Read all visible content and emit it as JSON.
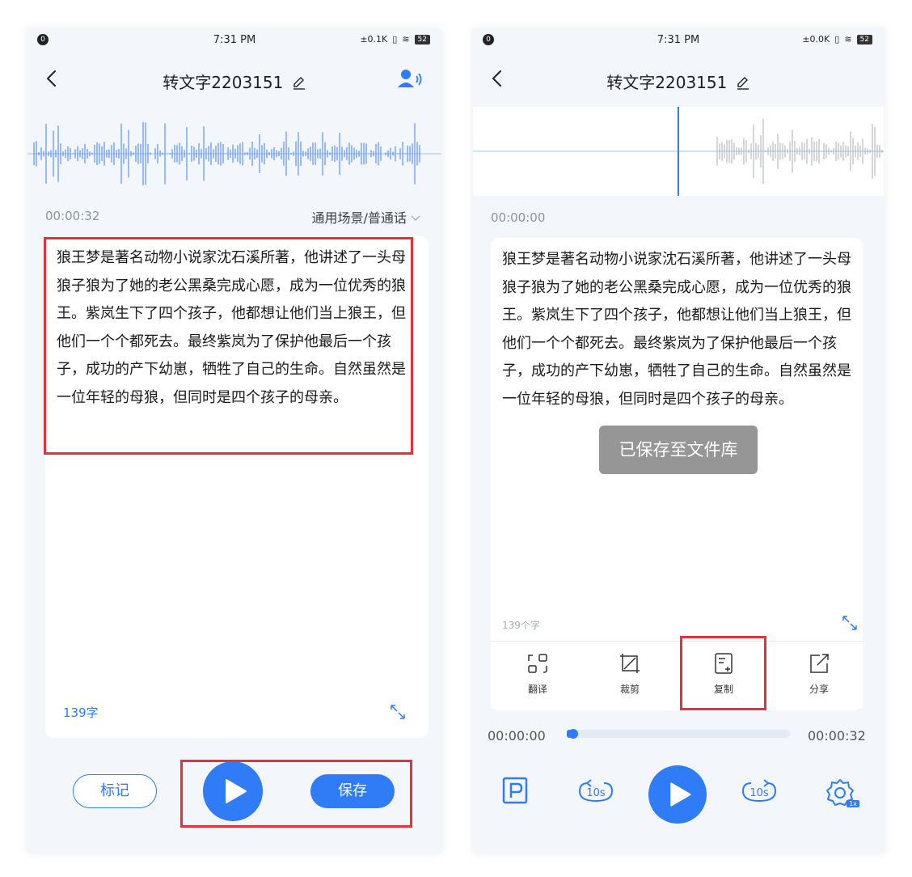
{
  "status_bar": {
    "time": "7:31 PM",
    "net_left": "±0.1K",
    "net_right": "±0.0K",
    "battery": "52",
    "notif_left": "0",
    "notif_right": "0"
  },
  "nav": {
    "title": "转文字2203151"
  },
  "left": {
    "time": "00:00:32",
    "scene": "通用场景/普通话",
    "transcript": "狼王梦是著名动物小说家沈石溪所著，他讲述了一头母狼子狼为了她的老公黑桑完成心愿，成为一位优秀的狼王。紫岚生下了四个孩子，他都想让他们当上狼王，但他们一个个都死去。最终紫岚为了保护他最后一个孩子，成功的产下幼崽，牺牲了自己的生命。自然虽然是一位年轻的母狼，但同时是四个孩子的母亲。",
    "word_count": "139字",
    "mark_button": "标记",
    "save_button": "保存"
  },
  "right": {
    "time": "00:00:00",
    "transcript": "狼王梦是著名动物小说家沈石溪所著，他讲述了一头母狼子狼为了她的老公黑桑完成心愿，成为一位优秀的狼王。紫岚生下了四个孩子，他都想让他们当上狼王，但他们一个个都死去。最终紫岚为了保护他最后一个孩子，成功的产下幼崽，牺牲了自己的生命。自然虽然是一位年轻的母狼，但同时是四个孩子的母亲。",
    "word_count": "139个字",
    "toast": "已保存至文件库",
    "tools": {
      "translate": "翻译",
      "crop": "裁剪",
      "copy": "复制",
      "share": "分享"
    },
    "playback": {
      "current": "00:00:00",
      "total": "00:00:32",
      "progress": 0.02
    },
    "speed": "1x"
  },
  "colors": {
    "accent": "#2f7cf6",
    "highlight": "#e0333e",
    "background": "#f3f6fb"
  }
}
